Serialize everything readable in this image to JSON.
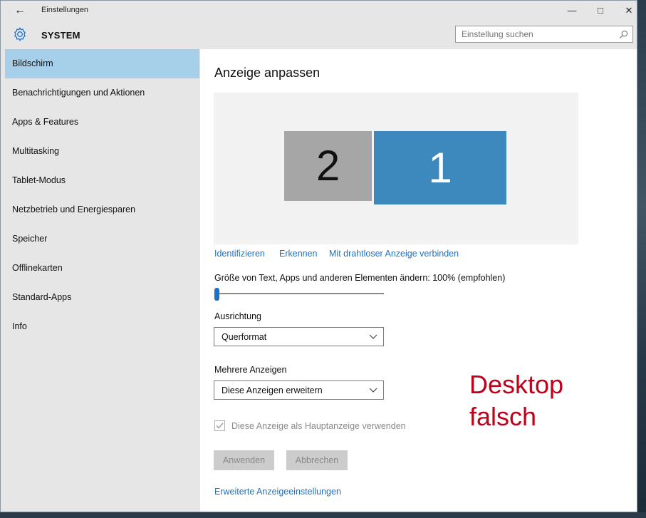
{
  "window": {
    "title": "Einstellungen",
    "back_icon": "←",
    "minimize_icon": "—",
    "maximize_icon": "□",
    "close_icon": "✕"
  },
  "header": {
    "section_title": "SYSTEM",
    "search_placeholder": "Einstellung suchen"
  },
  "sidebar": {
    "active_index": 0,
    "items": [
      {
        "label": "Bildschirm"
      },
      {
        "label": "Benachrichtigungen und Aktionen"
      },
      {
        "label": "Apps & Features"
      },
      {
        "label": "Multitasking"
      },
      {
        "label": "Tablet-Modus"
      },
      {
        "label": "Netzbetrieb und Energiesparen"
      },
      {
        "label": "Speicher"
      },
      {
        "label": "Offlinekarten"
      },
      {
        "label": "Standard-Apps"
      },
      {
        "label": "Info"
      }
    ]
  },
  "main": {
    "title": "Anzeige anpassen",
    "monitors": [
      {
        "number": "2"
      },
      {
        "number": "1"
      }
    ],
    "links": {
      "identify": "Identifizieren",
      "detect": "Erkennen",
      "wireless": "Mit drahtloser Anzeige verbinden",
      "advanced": "Erweiterte Anzeigeeinstellungen"
    },
    "scale_label": "Größe von Text, Apps und anderen Elementen ändern: 100% (empfohlen)",
    "scale_value": 0,
    "orientation_label": "Ausrichtung",
    "orientation_value": "Querformat",
    "multi_label": "Mehrere Anzeigen",
    "multi_value": "Diese Anzeigen erweitern",
    "primary_checkbox_label": "Diese Anzeige als Hauptanzeige verwenden",
    "primary_checked": true,
    "apply_label": "Anwenden",
    "cancel_label": "Abbrechen"
  },
  "annotation": {
    "line1": "Desktop",
    "line2": "falsch"
  },
  "colors": {
    "accent": "#1a73c8",
    "selected_nav": "#a6cfe9",
    "monitor_active": "#3d88bd",
    "monitor_inactive": "#a6a6a6",
    "annotation": "#c0001a"
  }
}
